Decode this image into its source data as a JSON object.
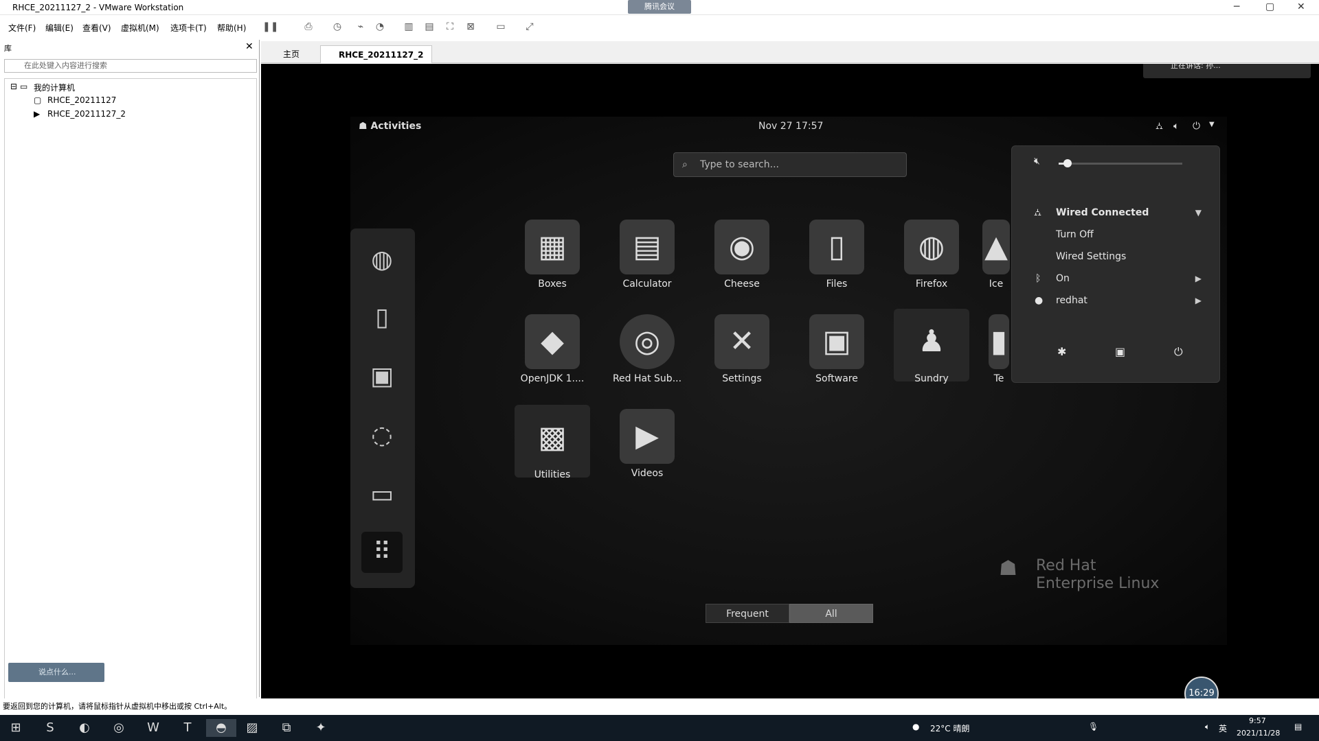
{
  "window": {
    "title": "RHCE_20211127_2 - VMware Workstation",
    "meeting_badge": "腾讯会议",
    "minimize": "─",
    "maximize": "▢",
    "close": "✕"
  },
  "menu": [
    "文件(F)",
    "编辑(E)",
    "查看(V)",
    "虚拟机(M)",
    "选项卡(T)",
    "帮助(H)"
  ],
  "library": {
    "header": "库",
    "close": "✕",
    "search_placeholder": "在此处键入内容进行搜索",
    "root": "我的计算机",
    "items": [
      "RHCE_20211127",
      "RHCE_20211127_2"
    ],
    "chat_prompt": "说点什么..."
  },
  "tabs": [
    {
      "label": "主页"
    },
    {
      "label": "RHCE_20211127_2"
    }
  ],
  "gnome": {
    "activities": "Activities",
    "datetime": "Nov 27  17:57",
    "search_placeholder": "Type to search...",
    "apps": [
      {
        "label": "Boxes",
        "icon": "boxes-icon",
        "glyph": "▦"
      },
      {
        "label": "Calculator",
        "icon": "calculator-icon",
        "glyph": "▤"
      },
      {
        "label": "Cheese",
        "icon": "cheese-icon",
        "glyph": "◉"
      },
      {
        "label": "Files",
        "icon": "files-icon",
        "glyph": "▯"
      },
      {
        "label": "Firefox",
        "icon": "firefox-icon",
        "glyph": "◍"
      },
      {
        "label": "Ice",
        "icon": "ice-icon",
        "glyph": "▲"
      },
      {
        "label": "OpenJDK 1....",
        "icon": "openjdk-icon",
        "glyph": "◆"
      },
      {
        "label": "Red Hat Sub...",
        "icon": "redhat-sub-icon",
        "glyph": "◎"
      },
      {
        "label": "Settings",
        "icon": "settings-icon",
        "glyph": "✕"
      },
      {
        "label": "Software",
        "icon": "software-icon",
        "glyph": "▣"
      },
      {
        "label": "Sundry",
        "icon": "sundry-icon",
        "glyph": "♟"
      },
      {
        "label": "Te",
        "icon": "terminal-partial-icon",
        "glyph": "▮"
      },
      {
        "label": "Utilities",
        "icon": "utilities-icon",
        "glyph": "▩"
      },
      {
        "label": "Videos",
        "icon": "videos-icon",
        "glyph": "▶"
      }
    ],
    "dash": [
      {
        "icon": "firefox-icon",
        "glyph": "◍"
      },
      {
        "icon": "files-icon",
        "glyph": "▯"
      },
      {
        "icon": "software-icon",
        "glyph": "▣"
      },
      {
        "icon": "help-icon",
        "glyph": "◌"
      },
      {
        "icon": "terminal-icon",
        "glyph": "▭"
      },
      {
        "icon": "show-apps-icon",
        "glyph": "⠿"
      }
    ],
    "frequent": "Frequent",
    "all": "All",
    "system_menu": {
      "volume_level": 0.07,
      "wired": "Wired Connected",
      "turn_off": "Turn Off",
      "wired_settings": "Wired Settings",
      "bluetooth": "On",
      "user": "redhat"
    },
    "branding": {
      "line1": "Red Hat",
      "line2": "Enterprise Linux"
    },
    "recording": "正在讲话: 孙...",
    "timer": "16:29"
  },
  "status_text": "要返回到您的计算机，请将鼠标指针从虚拟机中移出或按 Ctrl+Alt。",
  "taskbar": {
    "weather": "22°C  晴朗",
    "lang": "英",
    "time": "9:57",
    "date": "2021/11/28"
  }
}
